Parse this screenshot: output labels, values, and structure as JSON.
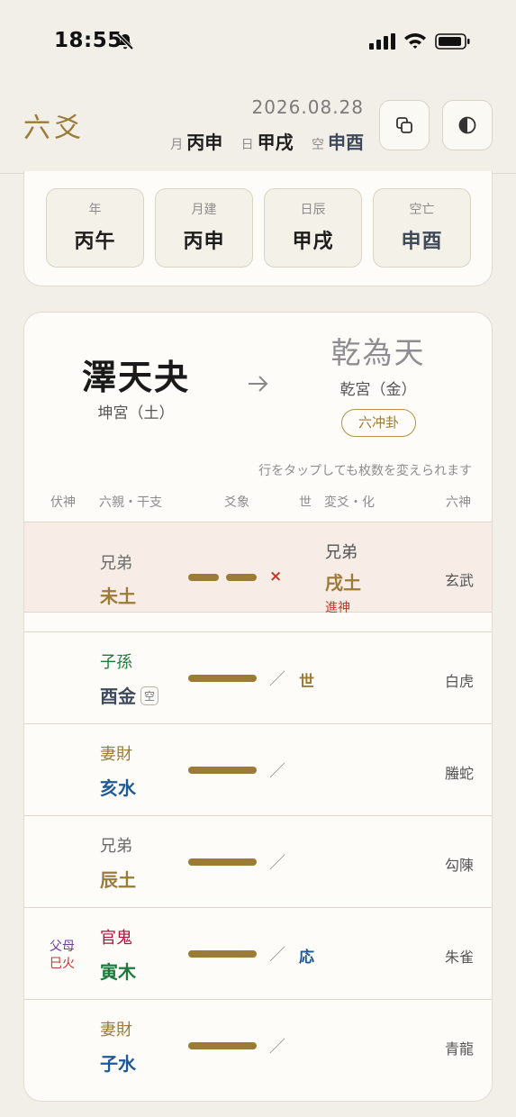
{
  "status": {
    "time": "18:55"
  },
  "header": {
    "title": "六爻",
    "date": "2026.08.28",
    "pillars": [
      {
        "label": "月",
        "value": "丙申"
      },
      {
        "label": "日",
        "value": "甲戌"
      },
      {
        "label": "空",
        "value": "申酉"
      }
    ],
    "buttons": [
      {
        "name": "copy",
        "icon": "copy-icon"
      },
      {
        "name": "theme",
        "icon": "contrast-icon"
      }
    ]
  },
  "pillar_card": [
    {
      "label": "年",
      "value": "丙午"
    },
    {
      "label": "月建",
      "value": "丙申"
    },
    {
      "label": "日辰",
      "value": "甲戌"
    },
    {
      "label": "空亡",
      "value": "申酉"
    }
  ],
  "hexagram": {
    "original": {
      "name": "澤天夬",
      "palace": "坤宮（土）"
    },
    "changed": {
      "name": "乾為天",
      "palace": "乾宮（金）",
      "badge": "六冲卦"
    },
    "hint": "行をタップしても枚数を変えられます",
    "columns": [
      "伏神",
      "六親・干支",
      "爻象",
      "世",
      "変爻・化",
      "六神"
    ]
  },
  "lines": [
    {
      "relative": "兄弟",
      "branch": "未土",
      "type": "yin",
      "moving": true,
      "mark": "×",
      "role": "",
      "change": {
        "relative": "兄弟",
        "branch": "戌土",
        "note": "進神"
      },
      "god": "玄武",
      "void": ""
    },
    {
      "relative": "子孫",
      "branch": "酉金",
      "type": "yang",
      "moving": false,
      "mark": "／",
      "role": "世",
      "change": null,
      "god": "白虎",
      "void": "空"
    },
    {
      "relative": "妻財",
      "branch": "亥水",
      "type": "yang",
      "moving": false,
      "mark": "／",
      "role": "",
      "change": null,
      "god": "螣蛇",
      "void": ""
    },
    {
      "relative": "兄弟",
      "branch": "辰土",
      "type": "yang",
      "moving": false,
      "mark": "／",
      "role": "",
      "change": null,
      "god": "勾陳",
      "void": ""
    },
    {
      "relative": "官鬼",
      "branch": "寅木",
      "type": "yang",
      "moving": false,
      "mark": "／",
      "role": "応",
      "change": null,
      "god": "朱雀",
      "void": "",
      "hidden": {
        "relative": "父母",
        "branch": "巳火"
      }
    },
    {
      "relative": "妻財",
      "branch": "子水",
      "type": "yang",
      "moving": false,
      "mark": "／",
      "role": "",
      "change": null,
      "god": "青龍",
      "void": ""
    }
  ],
  "colors": {
    "accent": "#9b7b35",
    "earth": "#9b7b35",
    "metal": "#3f4a5c",
    "water": "#1f5a96",
    "wood": "#1d7a3a",
    "fire": "#b0123b",
    "moving_bg": "#f8ece7"
  }
}
